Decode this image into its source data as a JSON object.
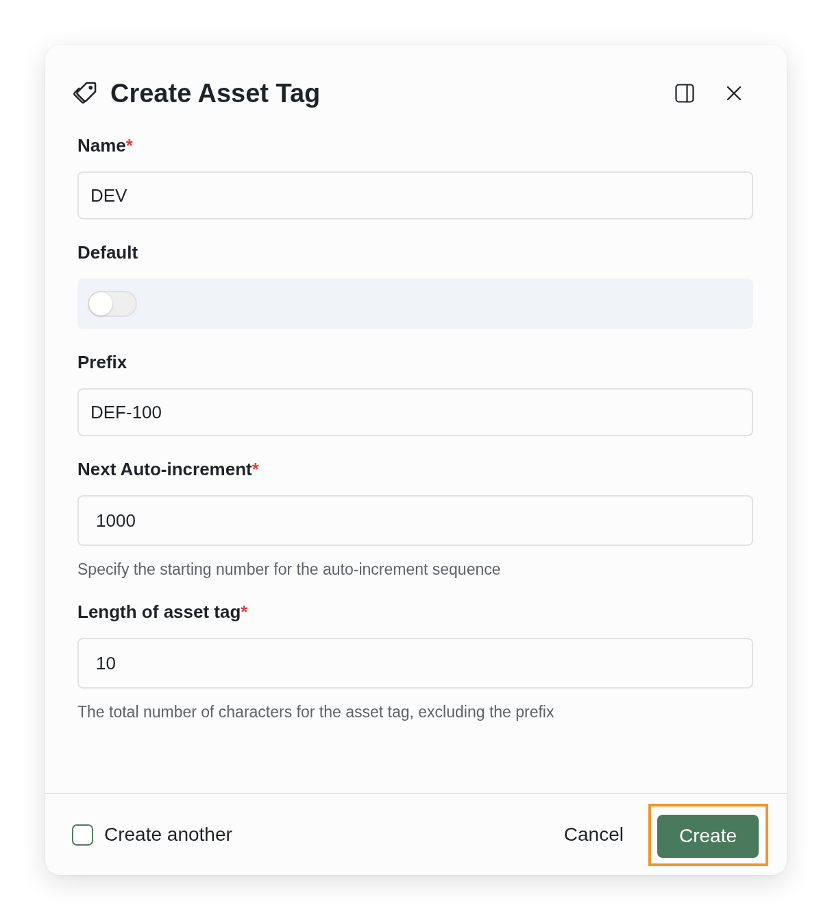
{
  "dialog": {
    "title": "Create Asset Tag"
  },
  "fields": [
    {
      "kind": "text",
      "label": "Name",
      "required_mark": "*",
      "value": "DEV"
    },
    {
      "kind": "toggle",
      "label": "Default",
      "on": false
    },
    {
      "kind": "text",
      "label": "Prefix",
      "value": "DEF-100"
    },
    {
      "kind": "number",
      "label": "Next Auto-increment",
      "required_mark": "*",
      "value": "1000",
      "help": "Specify the starting number for the auto-increment sequence"
    },
    {
      "kind": "number",
      "label": "Length of asset tag",
      "required_mark": "*",
      "value": "10",
      "help": "The total number of characters for the asset tag, excluding the prefix"
    }
  ],
  "footer": {
    "create_another": {
      "label": "Create another",
      "checked": false
    },
    "buttons": [
      {
        "kind": "secondary",
        "label": "Cancel",
        "highlighted": false
      },
      {
        "kind": "primary",
        "label": "Create",
        "highlighted": true
      }
    ]
  }
}
